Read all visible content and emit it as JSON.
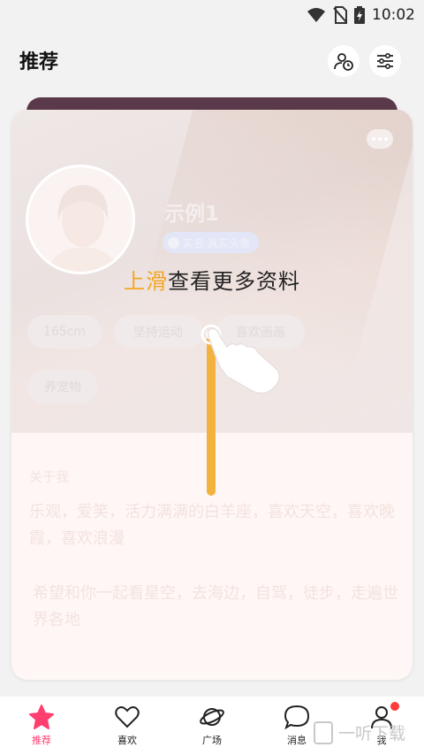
{
  "status_bar": {
    "time": "10:02"
  },
  "header": {
    "title": "推荐"
  },
  "profile": {
    "name": "示例1",
    "verify_badge": "实名·真实头像",
    "tags": [
      "165cm",
      "坚持运动",
      "喜欢画画",
      "养宠物"
    ]
  },
  "about": {
    "title": "关于我",
    "paragraph1": "乐观，爱笑，活力满满的白羊座，喜欢天空，喜欢晚霞，喜欢浪漫",
    "paragraph2": "希望和你一起看星空，去海边，自驾，徒步，走遍世界各地"
  },
  "guide": {
    "highlight": "上滑",
    "text": "查看更多资料"
  },
  "tabbar": {
    "tabs": [
      {
        "label": "推荐",
        "icon": "star-icon",
        "active": true
      },
      {
        "label": "喜欢",
        "icon": "heart-icon",
        "active": false
      },
      {
        "label": "广场",
        "icon": "planet-icon",
        "active": false
      },
      {
        "label": "消息",
        "icon": "chat-bubble-icon",
        "active": false
      },
      {
        "label": "我",
        "icon": "profile-icon",
        "active": false
      }
    ]
  },
  "watermark": {
    "text": "一听下载"
  },
  "colors": {
    "accent": "#ff3d6e",
    "guide_highlight": "#f5a623",
    "guide_line": "#f3b23d"
  }
}
